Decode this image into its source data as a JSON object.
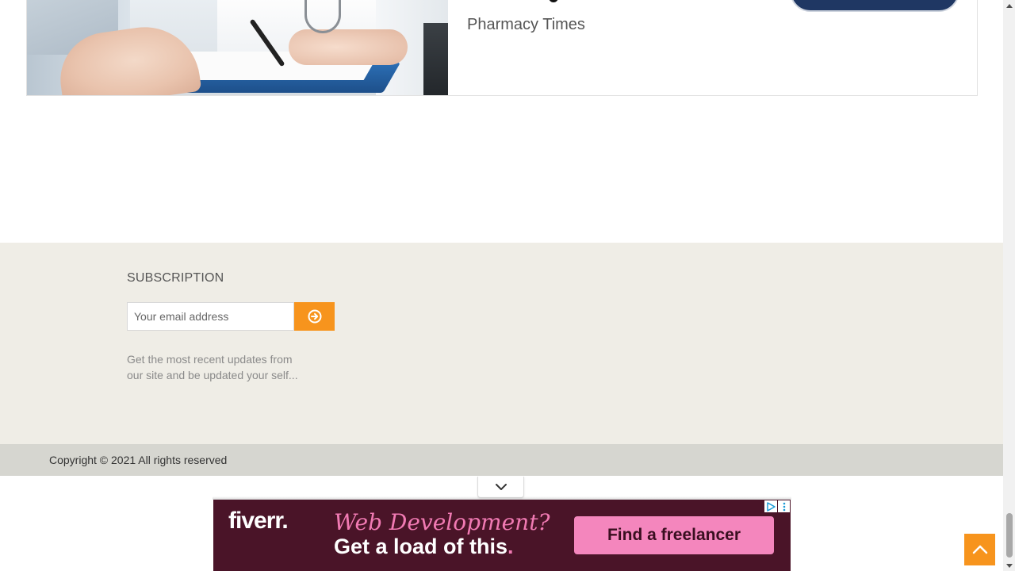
{
  "article_card": {
    "source": "Pharmacy Times"
  },
  "subscription": {
    "title": "SUBSCRIPTION",
    "email_placeholder": "Your email address",
    "submit_icon": "arrow-circle-right-icon",
    "description": "Get the most recent updates from our site and be updated your self..."
  },
  "footer": {
    "copyright": "Copyright © 2021 All rights reserved"
  },
  "ad": {
    "toggle_icon": "chevron-down-icon",
    "brand": "fiverr",
    "brand_dot": ".",
    "headline": "Web Development?",
    "subline": "Get a load of this",
    "subline_dot": ".",
    "cta": "Find a freelancer",
    "adchoices_icon": "adchoices-icon",
    "menu_icon": "vertical-dots-icon",
    "colors": {
      "background": "#4a1428",
      "accent_pink": "#f17ab3",
      "cta_background": "#f486bd"
    }
  },
  "back_to_top": {
    "icon": "chevron-up-icon",
    "color": "#f7941d"
  },
  "colors": {
    "accent_orange": "#f7941d",
    "footer_background": "#efede6",
    "copyright_bar": "#d6d6d0"
  }
}
